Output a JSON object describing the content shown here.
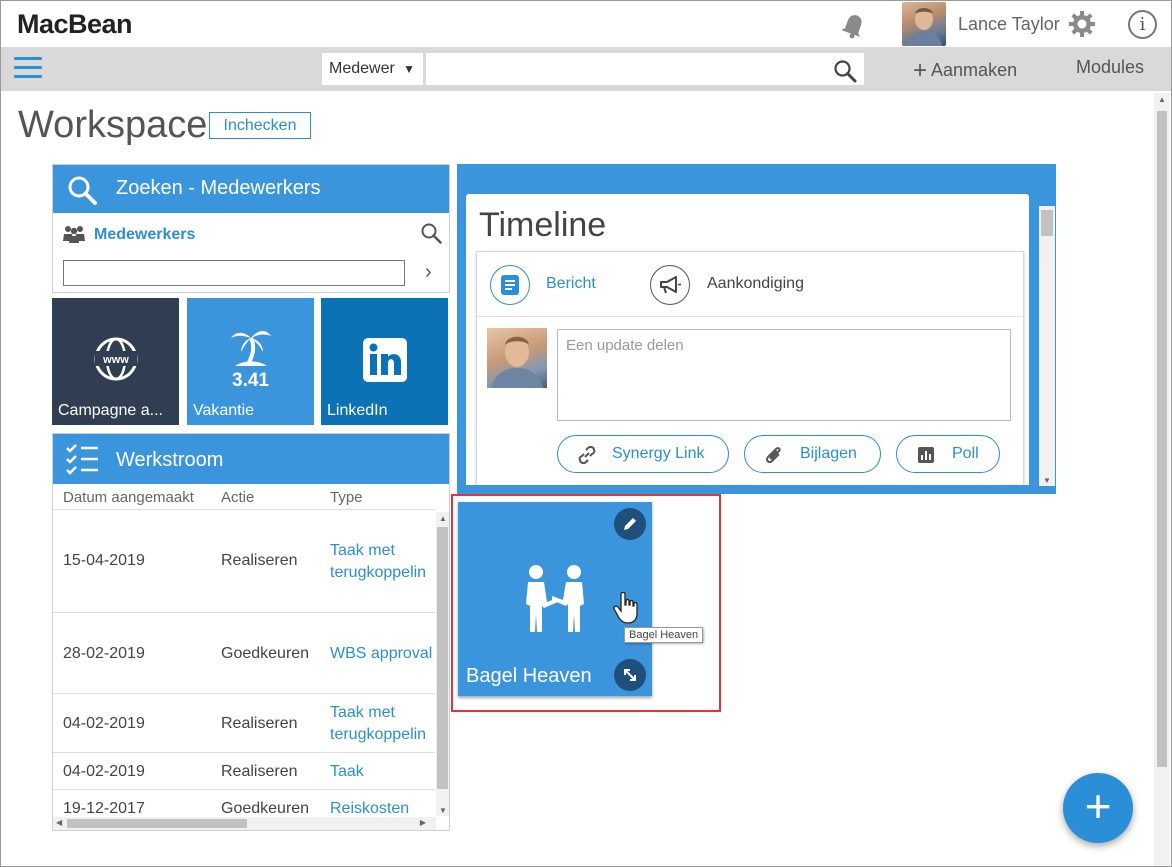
{
  "app": {
    "logo": "MacBean",
    "user_name": "Lance Taylor"
  },
  "nav": {
    "search_scope": "Medewer",
    "search_placeholder": "",
    "create_label": "Aanmaken",
    "modules_label": "Modules"
  },
  "workspace": {
    "title": "Workspace",
    "checkin_label": "Inchecken"
  },
  "search_widget": {
    "title": "Zoeken - Medewerkers",
    "label": "Medewerkers"
  },
  "tiles": [
    {
      "label": "Campagne a...",
      "icon": "www-globe-icon"
    },
    {
      "label": "Vakantie",
      "value": "3.41",
      "icon": "palm-tree-icon"
    },
    {
      "label": "LinkedIn",
      "icon": "linkedin-icon"
    }
  ],
  "workflow": {
    "title": "Werkstroom",
    "columns": [
      "Datum aangemaakt",
      "Actie",
      "Type"
    ],
    "rows": [
      {
        "date": "15-04-2019",
        "action": "Realiseren",
        "type_line1": "Taak met",
        "type_line2": "terugkoppelin"
      },
      {
        "date": "28-02-2019",
        "action": "Goedkeuren",
        "type_line1": "WBS approval",
        "type_line2": ""
      },
      {
        "date": "04-02-2019",
        "action": "Realiseren",
        "type_line1": "Taak met",
        "type_line2": "terugkoppelin"
      },
      {
        "date": "04-02-2019",
        "action": "Realiseren",
        "type_line1": "Taak",
        "type_line2": ""
      },
      {
        "date": "19-12-2017",
        "action": "Goedkeuren",
        "type_line1": "Reiskosten",
        "type_line2": ""
      }
    ]
  },
  "timeline": {
    "title": "Timeline",
    "message_label": "Bericht",
    "announcement_label": "Aankondiging",
    "update_placeholder": "Een update delen",
    "synergy_link_label": "Synergy Link",
    "attachments_label": "Bijlagen",
    "poll_label": "Poll"
  },
  "bagel": {
    "label": "Bagel Heaven",
    "tooltip": "Bagel Heaven"
  },
  "colors": {
    "accent": "#3b95dc",
    "dark_tile": "#2f3e52",
    "linkedin": "#0b72b5",
    "highlight_frame": "#e0353e"
  }
}
